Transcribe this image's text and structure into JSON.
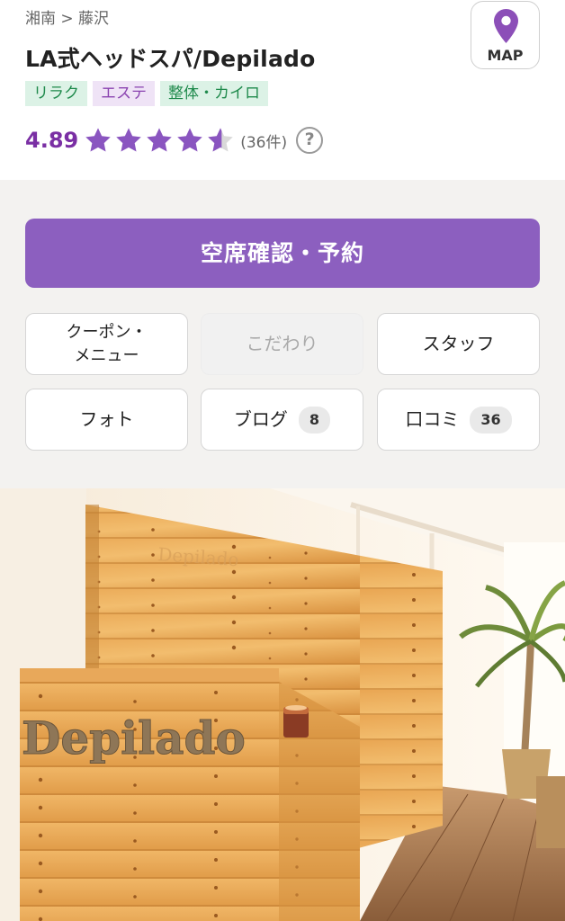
{
  "header": {
    "breadcrumb": "湘南 > 藤沢",
    "title": "LA式ヘッドスパ/Depilado",
    "tags": [
      "リラク",
      "エステ",
      "整体・カイロ"
    ],
    "rating": {
      "score": "4.89",
      "stars_value": 4.89,
      "count": "(36件)",
      "help_glyph": "?"
    },
    "map_label": "MAP"
  },
  "actions": {
    "reserve_label": "空席確認・予約",
    "coupon_line1": "クーポン・",
    "coupon_line2": "メニュー",
    "kodawari_label": "こだわり",
    "staff_label": "スタッフ",
    "photo_label": "フォト",
    "blog_label": "ブログ",
    "blog_count": "8",
    "reviews_label": "口コミ",
    "reviews_count": "36"
  },
  "salon_photo": {
    "sign_text": "Depilado",
    "wall_text": "Depilado"
  },
  "colors": {
    "accent": "#8c5fbf",
    "star": "#8a55c0",
    "score": "#7a2fa4",
    "tag_green_bg": "#dcf2e6",
    "tag_purple_bg": "#efe3f6"
  },
  "icons": {
    "map": "map-pin-icon",
    "star": "star-icon",
    "help": "question-circle-icon"
  }
}
